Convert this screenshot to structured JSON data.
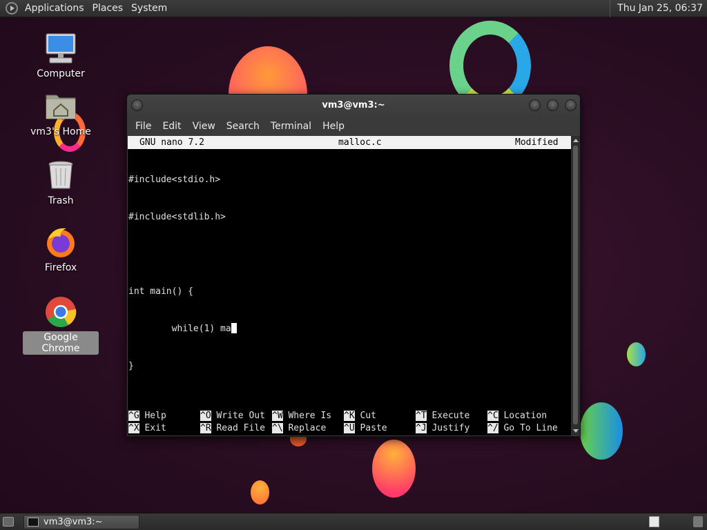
{
  "top_panel": {
    "menus": [
      "Applications",
      "Places",
      "System"
    ],
    "clock": "Thu Jan 25, 06:37"
  },
  "desktop_icons": [
    {
      "label": "Computer",
      "icon": "computer-icon"
    },
    {
      "label": "vm3's Home",
      "icon": "home-folder-icon"
    },
    {
      "label": "Trash",
      "icon": "trash-icon"
    },
    {
      "label": "Firefox",
      "icon": "firefox-icon"
    },
    {
      "label": "Google Chrome",
      "icon": "chrome-icon",
      "selected": true
    }
  ],
  "terminal": {
    "title": "vm3@vm3:~",
    "menu": [
      "File",
      "Edit",
      "View",
      "Search",
      "Terminal",
      "Help"
    ],
    "nano": {
      "version": "GNU nano 7.2",
      "filename": "malloc.c",
      "status": "Modified",
      "lines": [
        "#include<stdio.h>",
        "#include<stdlib.h>",
        "",
        "int main() {",
        "        while(1) ma",
        "}"
      ],
      "shortcuts_row1": [
        {
          "key": "^G",
          "action": "Help"
        },
        {
          "key": "^O",
          "action": "Write Out"
        },
        {
          "key": "^W",
          "action": "Where Is"
        },
        {
          "key": "^K",
          "action": "Cut"
        },
        {
          "key": "^T",
          "action": "Execute"
        },
        {
          "key": "^C",
          "action": "Location"
        }
      ],
      "shortcuts_row2": [
        {
          "key": "^X",
          "action": "Exit"
        },
        {
          "key": "^R",
          "action": "Read File"
        },
        {
          "key": "^\\",
          "action": "Replace"
        },
        {
          "key": "^U",
          "action": "Paste"
        },
        {
          "key": "^J",
          "action": "Justify"
        },
        {
          "key": "^/",
          "action": "Go To Line"
        }
      ]
    }
  },
  "taskbar": {
    "task_label": "vm3@vm3:~"
  },
  "colors": {
    "panel": "#333333",
    "nano_header_bg": "#f2f2f2",
    "terminal_bg": "#000000"
  }
}
